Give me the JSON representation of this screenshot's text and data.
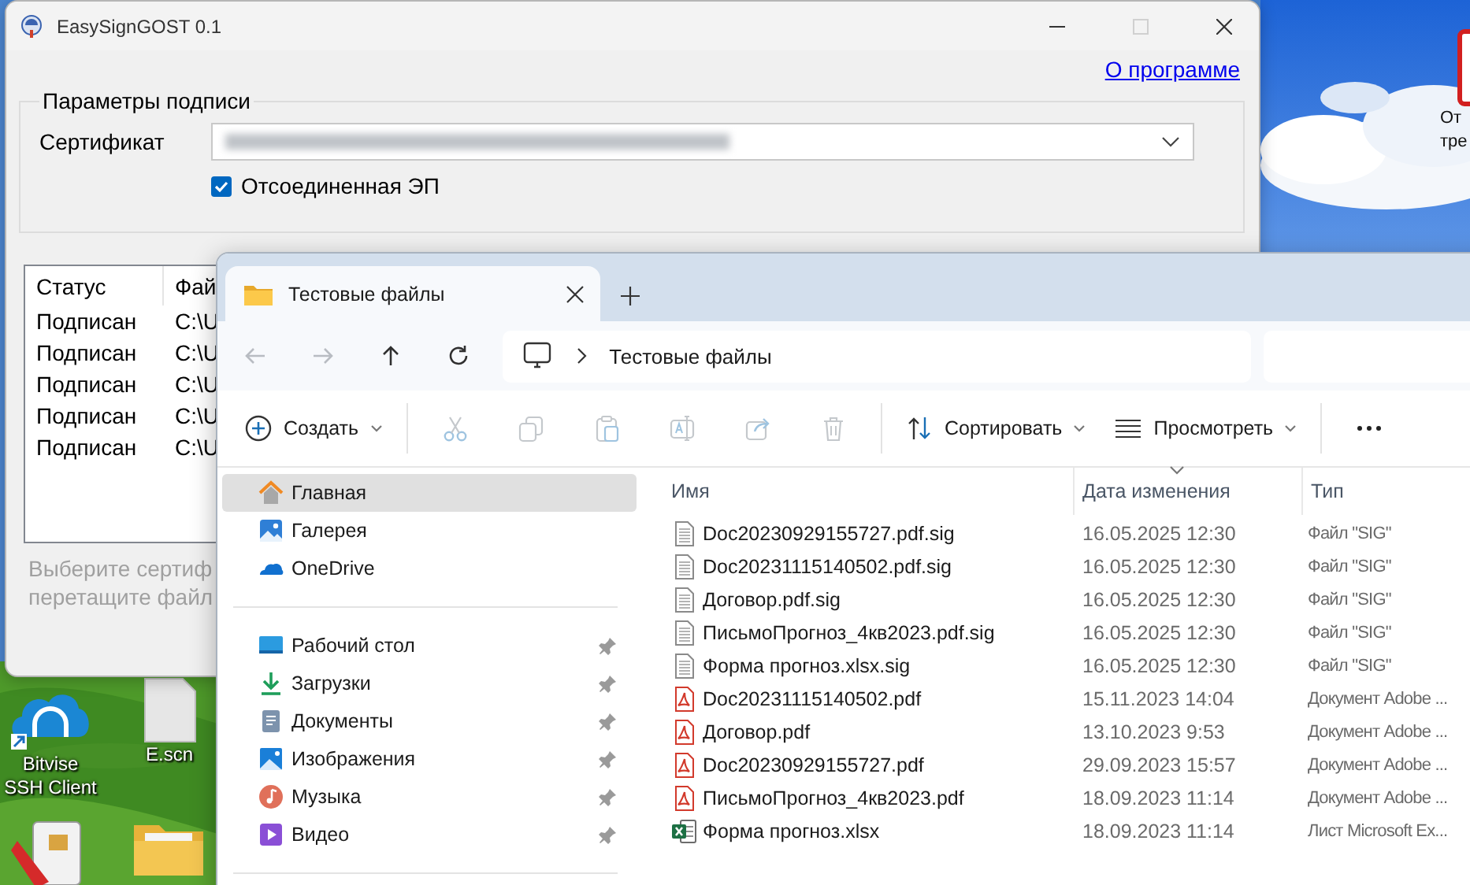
{
  "desktop": {
    "icons": [
      {
        "kind": "cloud-app",
        "label": "Bitvise SSH Client"
      },
      {
        "kind": "blank-file",
        "label": "E.scn"
      },
      {
        "kind": "card-reader"
      },
      {
        "kind": "folder"
      },
      {
        "kind": "app-tile",
        "label": "От тре"
      }
    ]
  },
  "sign_window": {
    "title": "EasySignGOST 0.1",
    "window_buttons": [
      {
        "kind": "minimize",
        "disabled": false
      },
      {
        "kind": "maximize",
        "disabled": true
      },
      {
        "kind": "close",
        "disabled": false
      }
    ],
    "about_link": "О программе",
    "group_title": "Параметры подписи",
    "certificate_label": "Сертификат",
    "detached_signature": {
      "label": "Отсоединенная ЭП",
      "checked": true
    },
    "list": {
      "columns": [
        "Статус",
        "Фай"
      ],
      "rows": [
        [
          "Подписан",
          "C:\\U"
        ],
        [
          "Подписан",
          "C:\\U"
        ],
        [
          "Подписан",
          "C:\\U"
        ],
        [
          "Подписан",
          "C:\\U"
        ],
        [
          "Подписан",
          "C:\\U"
        ]
      ]
    },
    "hint_lines": [
      "Выберите сертиф",
      "перетащите файл"
    ]
  },
  "explorer": {
    "tabs": [
      {
        "label": "Тестовые файлы",
        "selected": true
      }
    ],
    "nav_buttons": [
      {
        "kind": "back",
        "disabled": true
      },
      {
        "kind": "forward",
        "disabled": true
      },
      {
        "kind": "up",
        "disabled": false
      },
      {
        "kind": "refresh",
        "disabled": false
      }
    ],
    "address": [
      "Тестовые файлы"
    ],
    "toolbar": [
      [
        {
          "kind": "new",
          "label": "Создать",
          "menu": true,
          "disabled": false
        }
      ],
      [
        {
          "kind": "cut",
          "disabled": true
        },
        {
          "kind": "copy",
          "disabled": true
        },
        {
          "kind": "paste",
          "disabled": true
        },
        {
          "kind": "rename",
          "disabled": true
        },
        {
          "kind": "share",
          "disabled": true
        },
        {
          "kind": "delete",
          "disabled": true
        }
      ],
      [
        {
          "kind": "sort",
          "label": "Сортировать",
          "menu": true,
          "disabled": false
        },
        {
          "kind": "view",
          "label": "Просмотреть",
          "menu": true,
          "disabled": false
        }
      ],
      [
        {
          "kind": "more",
          "disabled": false
        }
      ]
    ],
    "sidebar": [
      {
        "items": [
          {
            "kind": "home",
            "label": "Главная",
            "selected": true,
            "pinned": false
          },
          {
            "kind": "gallery",
            "label": "Галерея",
            "selected": false,
            "pinned": false
          },
          {
            "kind": "onedrive",
            "label": "OneDrive",
            "selected": false,
            "pinned": false
          }
        ]
      },
      {
        "items": [
          {
            "kind": "desktop",
            "label": "Рабочий стол",
            "selected": false,
            "pinned": true
          },
          {
            "kind": "downloads",
            "label": "Загрузки",
            "selected": false,
            "pinned": true
          },
          {
            "kind": "documents",
            "label": "Документы",
            "selected": false,
            "pinned": true
          },
          {
            "kind": "pictures",
            "label": "Изображения",
            "selected": false,
            "pinned": true
          },
          {
            "kind": "music",
            "label": "Музыка",
            "selected": false,
            "pinned": true
          },
          {
            "kind": "video",
            "label": "Видео",
            "selected": false,
            "pinned": true
          }
        ]
      }
    ],
    "files": {
      "columns": [
        {
          "label": "Имя",
          "sorted": false
        },
        {
          "label": "Дата изменения",
          "sorted": true
        },
        {
          "label": "Тип",
          "sorted": false
        }
      ],
      "rows": [
        {
          "kind": "sig",
          "name": "Doc20230929155727.pdf.sig",
          "modified": "16.05.2025 12:30",
          "type": "Файл \"SIG\""
        },
        {
          "kind": "sig",
          "name": "Doc20231115140502.pdf.sig",
          "modified": "16.05.2025 12:30",
          "type": "Файл \"SIG\""
        },
        {
          "kind": "sig",
          "name": "Договор.pdf.sig",
          "modified": "16.05.2025 12:30",
          "type": "Файл \"SIG\""
        },
        {
          "kind": "sig",
          "name": "ПисьмоПрогноз_4кв2023.pdf.sig",
          "modified": "16.05.2025 12:30",
          "type": "Файл \"SIG\""
        },
        {
          "kind": "sig",
          "name": "Форма прогноз.xlsx.sig",
          "modified": "16.05.2025 12:30",
          "type": "Файл \"SIG\""
        },
        {
          "kind": "pdf",
          "name": "Doc20231115140502.pdf",
          "modified": "15.11.2023 14:04",
          "type": "Документ Adobe ..."
        },
        {
          "kind": "pdf",
          "name": "Договор.pdf",
          "modified": "13.10.2023 9:53",
          "type": "Документ Adobe ..."
        },
        {
          "kind": "pdf",
          "name": "Doc20230929155727.pdf",
          "modified": "29.09.2023 15:57",
          "type": "Документ Adobe ..."
        },
        {
          "kind": "pdf",
          "name": "ПисьмоПрогноз_4кв2023.pdf",
          "modified": "18.09.2023 11:14",
          "type": "Документ Adobe ..."
        },
        {
          "kind": "xlsx",
          "name": "Форма прогноз.xlsx",
          "modified": "18.09.2023 11:14",
          "type": "Лист Microsoft Ex..."
        }
      ]
    }
  }
}
